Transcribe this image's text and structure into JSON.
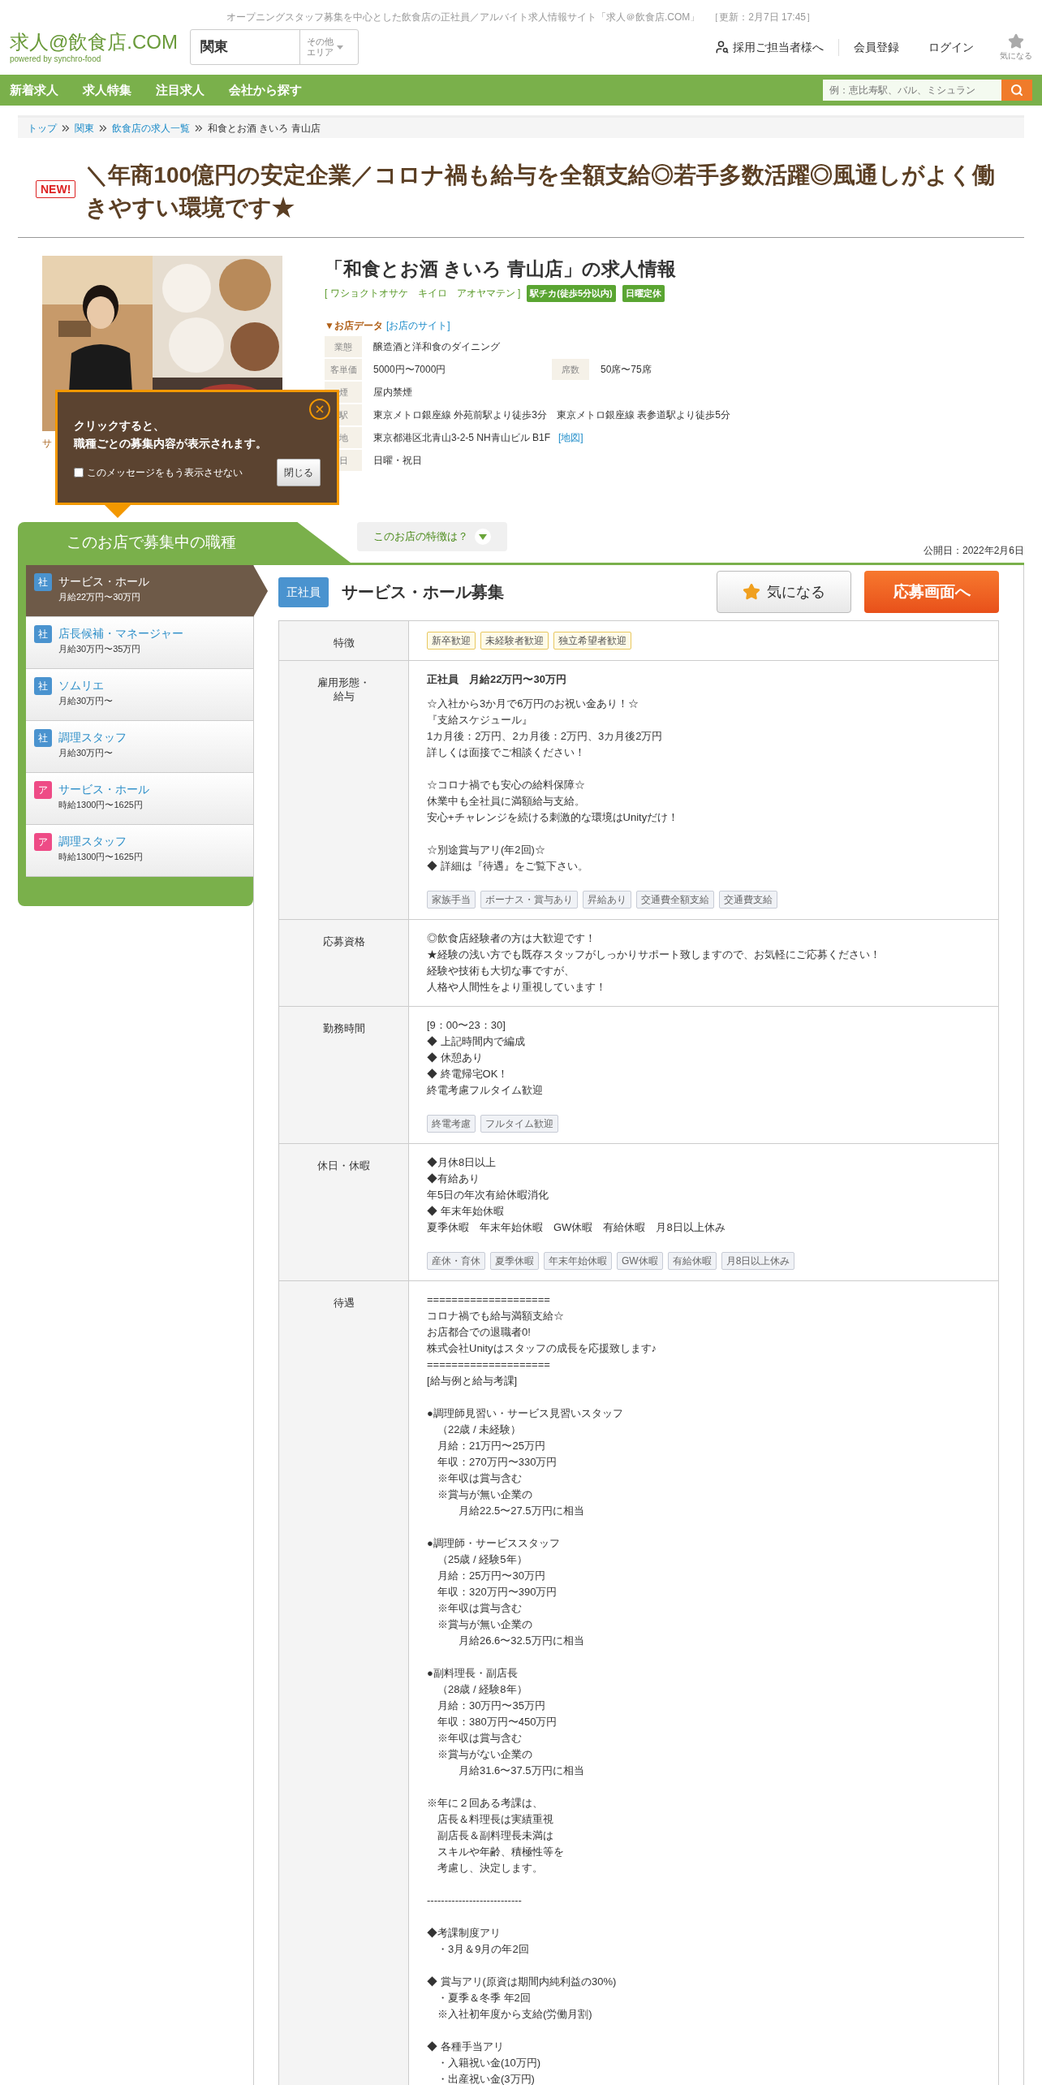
{
  "tagline": "オープニングスタッフ募集を中心とした飲食店の正社員／アルバイト求人情報サイト「求人＠飲食店.COM」",
  "updated": "［更新：2月7日 17:45］",
  "logo": {
    "main": "求人@飲食店.COM",
    "sub": "powered by synchro-food"
  },
  "area": {
    "value": "関東",
    "other": [
      "その他",
      "エリア"
    ]
  },
  "header_links": [
    {
      "label": "採用ご担当者様へ",
      "kind": "recruiter"
    },
    {
      "label": "会員登録",
      "kind": "plain"
    },
    {
      "label": "ログイン",
      "kind": "plain"
    }
  ],
  "favorites": {
    "label": "気になる"
  },
  "nav": [
    "新着求人",
    "求人特集",
    "注目求人",
    "会社から探す"
  ],
  "search": {
    "placeholder": "例：恵比寿駅、バル、ミシュラン"
  },
  "breadcrumb": [
    {
      "label": "トップ",
      "link": true
    },
    {
      "label": "関東",
      "link": true
    },
    {
      "label": "飲食店の求人一覧",
      "link": true
    },
    {
      "label": "和食とお酒 きいろ 青山店",
      "link": false
    }
  ],
  "headline": {
    "badge": "NEW!",
    "text": "＼年商100億円の安定企業／コロナ禍も給与を全額支給◎若手多数活躍◎風通しがよく働きやすい環境です★"
  },
  "photo": {
    "kind": "picture",
    "caption": "サ"
  },
  "shop": {
    "title": "「和食とお酒 きいろ 青山店」の求人情報",
    "kana": "[ ワショクトオサケ　キイロ　アオヤマテン ]",
    "tags": [
      "駅チカ(徒歩5分以内)",
      "日曜定休"
    ],
    "data_label": "▼お店データ",
    "site_link": "[お店のサイト]",
    "rows": [
      {
        "cells": [
          {
            "label": "業態",
            "value": "醸造酒と洋和食のダイニング"
          }
        ]
      },
      {
        "cells": [
          {
            "label": "客単価",
            "value": "5000円〜7000円"
          },
          {
            "label": "席数",
            "value": "50席〜75席"
          }
        ]
      },
      {
        "cells": [
          {
            "label": "煙",
            "value": "屋内禁煙"
          }
        ]
      },
      {
        "cells": [
          {
            "label": "駅",
            "value": "東京メトロ銀座線 外苑前駅より徒歩3分　東京メトロ銀座線 表参道駅より徒歩5分"
          }
        ]
      },
      {
        "cells": [
          {
            "label": "地",
            "value": "東京都港区北青山3-2-5 NH青山ビル B1F",
            "link": "[地図]"
          }
        ]
      },
      {
        "cells": [
          {
            "label": "日",
            "value": "日曜・祝日"
          }
        ]
      }
    ]
  },
  "popup": {
    "lines": [
      "クリックすると、",
      "職種ごとの募集内容が表示されます。"
    ],
    "checkbox": {
      "label": "このメッセージをもう表示させない",
      "checked": false
    },
    "close_button": "閉じる"
  },
  "jobs_panel": {
    "title": "このお店で募集中の職種",
    "features_toggle": "このお店の特徴は？",
    "published": "公開日：2022年2月6日",
    "jobs": [
      {
        "type": "社",
        "kind": "fulltime",
        "title": "サービス・ホール",
        "salary": "月給22万円〜30万円",
        "selected": true
      },
      {
        "type": "社",
        "kind": "fulltime",
        "title": "店長候補・マネージャー",
        "salary": "月給30万円〜35万円",
        "selected": false
      },
      {
        "type": "社",
        "kind": "fulltime",
        "title": "ソムリエ",
        "salary": "月給30万円〜",
        "selected": false
      },
      {
        "type": "社",
        "kind": "fulltime",
        "title": "調理スタッフ",
        "salary": "月給30万円〜",
        "selected": false
      },
      {
        "type": "ア",
        "kind": "parttime",
        "title": "サービス・ホール",
        "salary": "時給1300円〜1625円",
        "selected": false
      },
      {
        "type": "ア",
        "kind": "parttime",
        "title": "調理スタッフ",
        "salary": "時給1300円〜1625円",
        "selected": false
      }
    ]
  },
  "job": {
    "badge": "正社員",
    "title": "サービス・ホール募集",
    "fav_button": "気になる",
    "apply_button": "応募画面へ",
    "rows": [
      {
        "label": [
          "特徴"
        ],
        "kind": "features",
        "tags": [
          "新卒歓迎",
          "未経験者歓迎",
          "独立希望者歓迎"
        ]
      },
      {
        "label": [
          "雇用形態・",
          "給与"
        ],
        "kind": "details",
        "heading": "正社員　月給22万円〜30万円",
        "paragraphs": [
          [
            "☆入社から3か月で6万円のお祝い金あり！☆",
            "『支給スケジュール』",
            "1カ月後：2万円、2カ月後：2万円、3カ月後2万円",
            "詳しくは面接でご相談ください！"
          ],
          [
            "☆コロナ禍でも安心の給料保障☆",
            "休業中も全社員に満額給与支給。",
            "安心+チャレンジを続ける刺激的な環境はUnityだけ！"
          ],
          [
            "☆別途賞与アリ(年2回)☆",
            "◆ 詳細は『待遇』をご覧下さい。"
          ]
        ],
        "tags": [
          "家族手当",
          "ボーナス・賞与あり",
          "昇給あり",
          "交通費全額支給",
          "交通費支給"
        ]
      },
      {
        "label": [
          "応募資格"
        ],
        "kind": "details",
        "paragraphs": [
          [
            "◎飲食店経験者の方は大歓迎です！",
            "★経験の浅い方でも既存スタッフがしっかりサポート致しますので、お気軽にご応募ください！",
            "経験や技術も大切な事ですが、",
            "人格や人間性をより重視しています！"
          ]
        ]
      },
      {
        "label": [
          "勤務時間"
        ],
        "kind": "details",
        "paragraphs": [
          [
            "[9：00〜23：30]",
            "◆ 上記時間内で編成",
            "◆ 休憩あり",
            "◆ 終電帰宅OK！",
            "終電考慮フルタイム歓迎"
          ]
        ],
        "tags": [
          "終電考慮",
          "フルタイム歓迎"
        ]
      },
      {
        "label": [
          "休日・休暇"
        ],
        "kind": "details",
        "paragraphs": [
          [
            "◆月休8日以上",
            "◆有給あり",
            "年5日の年次有給休暇消化",
            "◆ 年末年始休暇",
            "夏季休暇　年末年始休暇　GW休暇　有給休暇　月8日以上休み"
          ]
        ],
        "tags": [
          "産休・育休",
          "夏季休暇",
          "年末年始休暇",
          "GW休暇",
          "有給休暇",
          "月8日以上休み"
        ]
      },
      {
        "label": [
          "待遇"
        ],
        "kind": "details",
        "paragraphs": [
          [
            "====================",
            "コロナ禍でも給与満額支給☆",
            "お店都合での退職者0!",
            "株式会社Unityはスタッフの成長を応援致します♪",
            "====================",
            "[給与例と給与考課]"
          ],
          [
            "●調理師見習い・サービス見習いスタッフ",
            "　（22歳 / 未経験）",
            "　月給：21万円〜25万円",
            "　年収：270万円〜330万円",
            "　※年収は賞与含む",
            "　※賞与が無い企業の",
            "　　　月給22.5〜27.5万円に相当"
          ],
          [
            "●調理師・サービススタッフ",
            "　（25歳 / 経験5年）",
            "　月給：25万円〜30万円",
            "　年収：320万円〜390万円",
            "　※年収は賞与含む",
            "　※賞与が無い企業の",
            "　　　月給26.6〜32.5万円に相当"
          ],
          [
            "●副料理長・副店長",
            "　（28歳 / 経験8年）",
            "　月給：30万円〜35万円",
            "　年収：380万円〜450万円",
            "　※年収は賞与含む",
            "　※賞与がない企業の",
            "　　　月給31.6〜37.5万円に相当"
          ],
          [
            "※年に２回ある考課は、",
            "　店長＆料理長は実績重視",
            "　副店長＆副料理長未満は",
            "　スキルや年齢、積極性等を",
            "　考慮し、決定します。"
          ],
          [
            "---------------------------"
          ],
          [
            "◆考課制度アリ",
            "　・3月＆9月の年2回"
          ],
          [
            "◆ 賞与アリ(原資は期間内純利益の30%)",
            "　・夏季＆冬季 年2回",
            "　※入社初年度から支給(労働月割)"
          ],
          [
            "◆ 各種手当アリ",
            "　・入籍祝い金(10万円)",
            "　・出産祝い金(3万円)"
          ]
        ]
      }
    ]
  }
}
